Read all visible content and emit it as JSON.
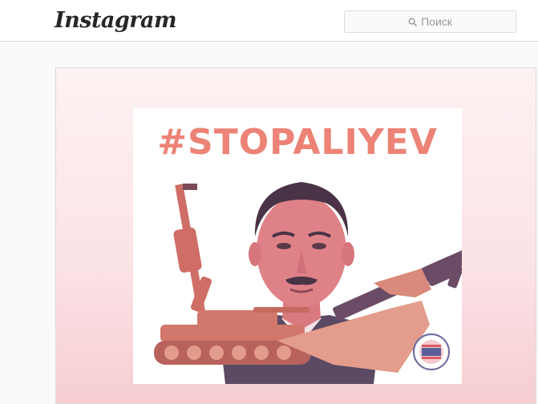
{
  "header": {
    "logo_text": "Instagram",
    "search": {
      "placeholder": "Поиск",
      "icon": "search-icon"
    }
  },
  "post": {
    "image": {
      "headline": "#STOPALIYEV",
      "depicts": [
        "portrait-photo",
        "assault-rifle",
        "tank",
        "circular-seal"
      ]
    }
  },
  "colors": {
    "headline": "#ec8376",
    "tint": "#e98b8f",
    "border": "#dbdbdb"
  }
}
